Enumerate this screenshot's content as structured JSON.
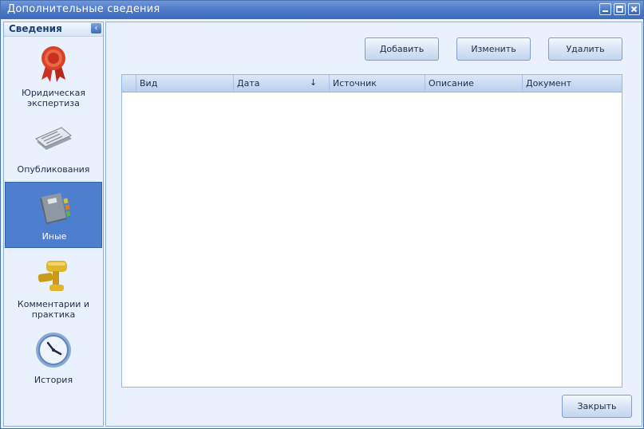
{
  "window": {
    "title": "Дополнительные сведения",
    "controls": [
      "minimize-icon",
      "maximize-icon",
      "close-icon"
    ]
  },
  "sidebar": {
    "title": "Сведения",
    "collapse_icon": "chevron-left-icon",
    "items": [
      {
        "label": "Юридическая экспертиза",
        "icon": "seal-ribbon-icon",
        "active": false
      },
      {
        "label": "Опубликования",
        "icon": "newspaper-icon",
        "active": false
      },
      {
        "label": "Иные",
        "icon": "book-icon",
        "active": true
      },
      {
        "label": "Комментарии и практика",
        "icon": "gavel-icon",
        "active": false
      },
      {
        "label": "История",
        "icon": "clock-icon",
        "active": false
      }
    ]
  },
  "toolbar": {
    "add_label": "Добавить",
    "edit_label": "Изменить",
    "delete_label": "Удалить"
  },
  "table": {
    "columns": [
      "Вид",
      "Дата",
      "Источник",
      "Описание",
      "Документ"
    ],
    "sorted_column": "Дата",
    "sort_direction": "descending",
    "rows": []
  },
  "footer": {
    "close_label": "Закрыть"
  },
  "colors": {
    "titlebar": "#4f7ccb",
    "active_item": "#4e7fcf",
    "panel_background": "#e8f1fc"
  }
}
